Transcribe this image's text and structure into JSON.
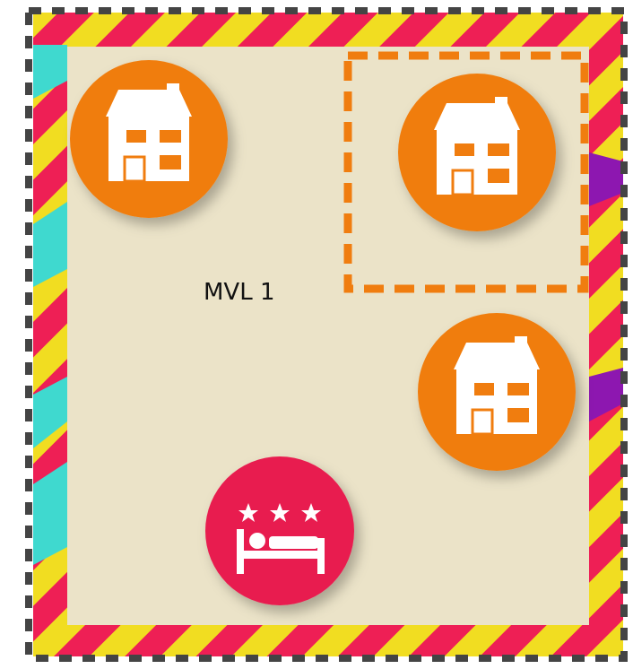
{
  "zone": {
    "label": "MVL 1",
    "stripe_colors": [
      "#ee1f55",
      "#f1dd21",
      "#3fd9cf",
      "#8d17b0"
    ],
    "fill_color": "#ebe3c8",
    "border_color": "#444444",
    "selection_color": "#f07d0f"
  },
  "markers": [
    {
      "icon": "house-icon",
      "color": "#f07d0f"
    },
    {
      "icon": "house-icon",
      "color": "#f07d0f"
    },
    {
      "icon": "house-icon",
      "color": "#f07d0f"
    },
    {
      "icon": "hotel-bed-icon",
      "stars": 3,
      "color": "#e81f50"
    }
  ]
}
